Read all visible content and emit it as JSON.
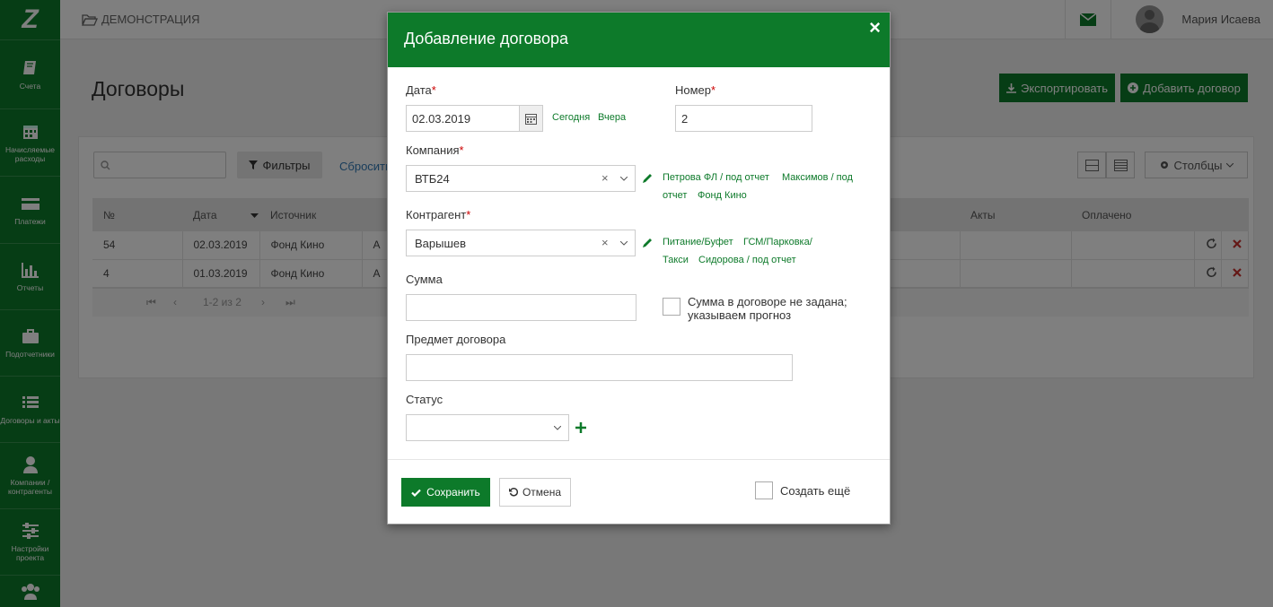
{
  "app": {
    "breadcrumb": "ДЕМОНСТРАЦИЯ",
    "user_name": "Мария Исаева"
  },
  "sidebar": {
    "logo": "Z",
    "items": [
      {
        "label": "Счета",
        "icon": "book-icon"
      },
      {
        "label": "Начисляемые расходы",
        "icon": "calendar-icon"
      },
      {
        "label": "Платежи",
        "icon": "credit-card-icon"
      },
      {
        "label": "Отчеты",
        "icon": "bar-chart-icon"
      },
      {
        "label": "Подотчетники",
        "icon": "briefcase-icon"
      },
      {
        "label": "Договоры и акты",
        "icon": "list-icon"
      },
      {
        "label": "Компании / контрагенты",
        "icon": "user-icon"
      },
      {
        "label": "Настройки проекта",
        "icon": "sliders-icon"
      },
      {
        "label": "",
        "icon": "users-icon"
      }
    ]
  },
  "page": {
    "title": "Договоры",
    "export_label": "Экспортировать",
    "add_label": "Добавить договор",
    "filters_label": "Фильтры",
    "reset_label": "Сбросить",
    "columns_label": "Столбцы",
    "table": {
      "headers": [
        "№",
        "Дата",
        "Источник",
        "",
        "Акты",
        "Оплачено"
      ],
      "rows": [
        {
          "num": "54",
          "date": "02.03.2019",
          "source": "Фонд Кино",
          "cut": "А"
        },
        {
          "num": "4",
          "date": "01.03.2019",
          "source": "Фонд Кино",
          "cut": "А"
        }
      ]
    },
    "pager_text": "1-2 из 2"
  },
  "modal": {
    "title": "Добавление договора",
    "close": "×",
    "date_label": "Дата",
    "date_value": "02.03.2019",
    "today_link": "Сегодня",
    "yesterday_link": "Вчера",
    "number_label": "Номер",
    "number_value": "2",
    "company_label": "Компания",
    "company_value": "ВТБ24",
    "company_quick": [
      "Петрова ФЛ / под отчет",
      "Максимов / под",
      "отчет",
      "Фонд Кино"
    ],
    "counterparty_label": "Контрагент",
    "counterparty_value": "Варышев",
    "counterparty_quick": [
      "Питание/Буфет",
      "ГСМ/Парковка/",
      "Такси",
      "Сидорова / под отчет"
    ],
    "sum_label": "Сумма",
    "sum_value": "",
    "sum_not_set_line1": "Сумма в договоре не задана;",
    "sum_not_set_line2": "указываем прогноз",
    "subject_label": "Предмет договора",
    "subject_value": "",
    "status_label": "Статус",
    "status_value": "",
    "save_label": "Сохранить",
    "cancel_label": "Отмена",
    "create_more_label": "Создать ещё",
    "required_mark": "*"
  },
  "colors": {
    "brand_green": "#0d7a2a",
    "required": "#cc0000",
    "delete_red": "#c9302c"
  }
}
